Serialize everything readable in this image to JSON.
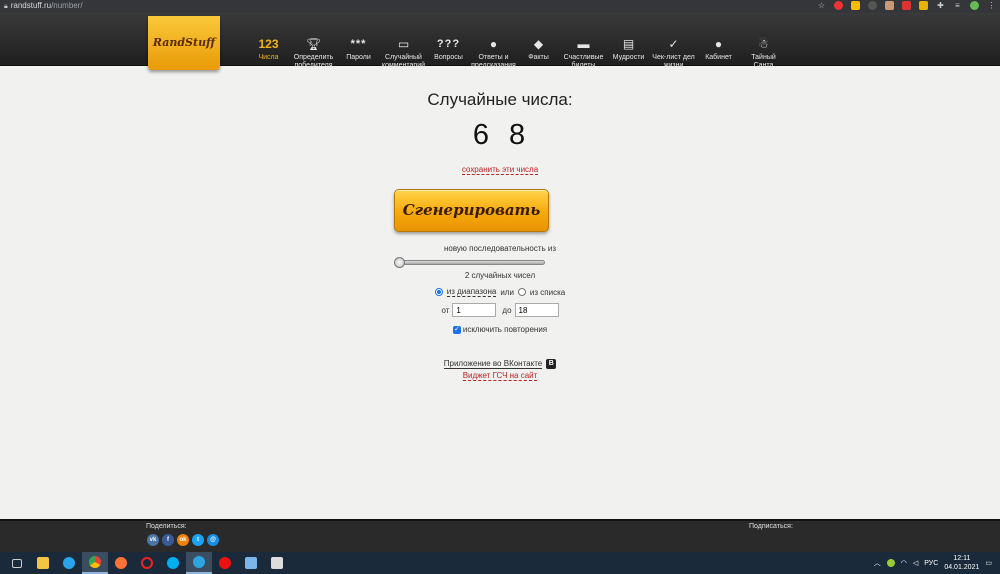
{
  "browser": {
    "url_host": "randstuff.ru",
    "url_path": "/number/"
  },
  "site": {
    "logo": "RandStuff",
    "nav": [
      {
        "icon_text": "123",
        "label": "Числа",
        "active": true,
        "icon": "numbers-icon"
      },
      {
        "icon_text": "",
        "label": "Определить победителя",
        "active": false,
        "icon": "trophy-icon"
      },
      {
        "icon_text": "***",
        "label": "Пароли",
        "active": false,
        "icon": "password-icon"
      },
      {
        "icon_text": "",
        "label": "Случайный комментарий",
        "active": false,
        "icon": "comment-icon"
      },
      {
        "icon_text": "???",
        "label": "Вопросы",
        "active": false,
        "icon": "questions-icon"
      },
      {
        "icon_text": "",
        "label": "Ответы и предсказания",
        "active": false,
        "icon": "magic-ball-icon"
      },
      {
        "icon_text": "",
        "label": "Факты",
        "active": false,
        "icon": "facts-icon"
      },
      {
        "icon_text": "",
        "label": "Счастливые билеты",
        "active": false,
        "icon": "ticket-icon"
      },
      {
        "icon_text": "",
        "label": "Мудрости",
        "active": false,
        "icon": "scroll-icon"
      },
      {
        "icon_text": "",
        "label": "Чек-лист дел жизни",
        "active": false,
        "icon": "checklist-icon"
      },
      {
        "icon_text": "",
        "label": "Кабинет",
        "active": false,
        "icon": "user-icon"
      },
      {
        "icon_text": "",
        "label": "Тайный Санта",
        "active": false,
        "icon": "santa-icon"
      }
    ]
  },
  "main": {
    "title": "Случайные числа:",
    "numbers": "6 8",
    "save_link": "сохранить эти числа",
    "generate_button": "Сгенерировать",
    "sequence_label": "новую последовательность из",
    "slider_value_fraction": 0.0,
    "count_label": "2 случайных чисел",
    "mode_range": "из диапазона",
    "mode_or": "или",
    "mode_list": "из списка",
    "from_label": "от",
    "from_value": "1",
    "to_label": "до",
    "to_value": "18",
    "exclude_repeats": "исключить повторения",
    "vk_app": "Приложение во ВКонтакте",
    "vk_badge": "В",
    "widget": "Виджет ГСЧ на сайт"
  },
  "footer": {
    "share_label": "Поделиться:",
    "subscribe_label": "Подписаться:",
    "social": [
      {
        "name": "vk-share-icon",
        "glyph": "vk",
        "color": "#4c75a3"
      },
      {
        "name": "facebook-share-icon",
        "glyph": "f",
        "color": "#3b5998"
      },
      {
        "name": "odnoklassniki-share-icon",
        "glyph": "ok",
        "color": "#ee8208"
      },
      {
        "name": "twitter-share-icon",
        "glyph": "t",
        "color": "#1da1f2"
      },
      {
        "name": "moimir-share-icon",
        "glyph": "@",
        "color": "#168de2"
      }
    ]
  },
  "taskbar": {
    "lang": "РУС",
    "time": "12:11",
    "date": "04.01.2021"
  },
  "colors": {
    "accent": "#f2b411",
    "link_red": "#bb2222",
    "header_bg": "#2b2b2b"
  }
}
